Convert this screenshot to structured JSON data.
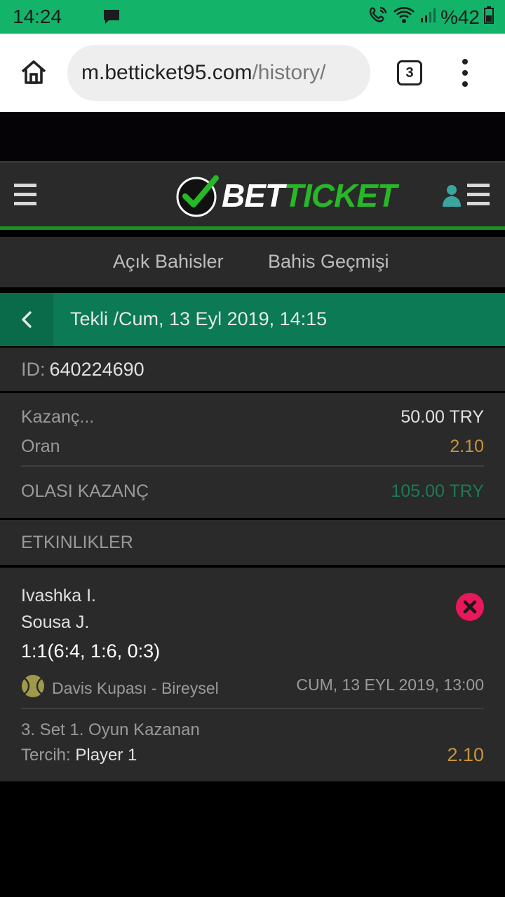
{
  "status": {
    "time": "14:24",
    "battery": "%42"
  },
  "browser": {
    "url_host": "m.betticket95.com",
    "url_path": "/history/",
    "tab_count": "3"
  },
  "app": {
    "brand_part1": "BET",
    "brand_part2": "TICKET",
    "colors": {
      "accent_green": "#1d8f1d",
      "teal": "#0b7a55",
      "odds": "#c7943a",
      "win_green": "#1d7a55",
      "close_red": "#e8185a"
    }
  },
  "subnav": {
    "open_bets": "Açık Bahisler",
    "history": "Bahis Geçmişi"
  },
  "ticket": {
    "title": "Tekli /Cum, 13 Eyl 2019, 14:15",
    "id_label": "ID:",
    "id_value": "640224690",
    "stake_label": "Kazanç...",
    "stake_value": "50.00 TRY",
    "odds_label": "Oran",
    "odds_value": "2.10",
    "potential_label": "OLASI KAZANÇ",
    "potential_value": "105.00 TRY"
  },
  "events": {
    "header": "ETKINLIKLER",
    "items": [
      {
        "player1": "Ivashka I.",
        "player2": "Sousa J.",
        "score": "1:1(6:4, 1:6, 0:3)",
        "league": "Davis Kupası - Bireysel",
        "date": "CUM, 13 EYL 2019, 13:00",
        "market": "3. Set 1. Oyun Kazanan",
        "pick_label": "Tercih:",
        "pick_value": "Player 1",
        "odds": "2.10"
      }
    ]
  }
}
